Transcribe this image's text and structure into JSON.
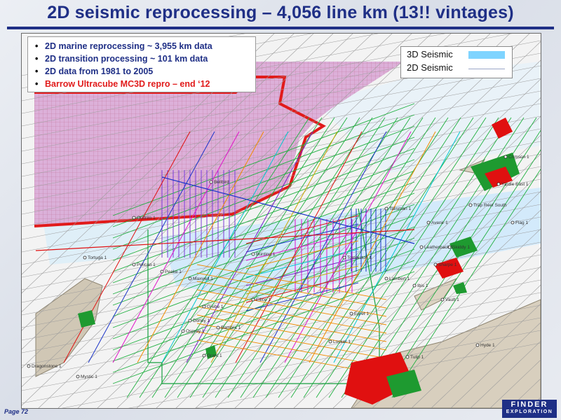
{
  "title": "2D seismic reprocessing – 4,056 line km (13!! vintages)",
  "bullets": [
    {
      "text": "2D marine reprocessing ~ 3,955 km data",
      "highlight": false
    },
    {
      "text": "2D transition processing ~ 101 km data",
      "highlight": false
    },
    {
      "text": "2D data from 1981 to 2005",
      "highlight": false
    },
    {
      "text": "Barrow Ultracube MC3D repro – end ‘12",
      "highlight": true
    }
  ],
  "legend": {
    "items": [
      {
        "label": "3D Seismic",
        "color": "#7fd4ff"
      },
      {
        "label": "2D Seismic",
        "color": "#9aa6c8"
      }
    ]
  },
  "map": {
    "colors": {
      "cube_fill": "#b98bc4",
      "cube_outline": "#e11b1b",
      "survey_3d": "#bfe3ff",
      "grey_lines": "#9c9c9c",
      "green_lines": "#20b040",
      "hydrocarbon": "#e01010",
      "islands": "#d0c7b5"
    },
    "well_labels": [
      "Bellbird",
      "Outtrim 1",
      "Tortuga 1",
      "Pelican 1",
      "Peake 1",
      "Maxwell 1",
      "Mystic 1",
      "Dragonstone 1",
      "Grant 1",
      "Trap Reef South",
      "Crimson 1",
      "Yardie East 1",
      "Doney 1",
      "Locker 1",
      "Skiddy 1",
      "Tulip 1",
      "Flag 1",
      "Hyde 1",
      "Avenir 1",
      "Sharpe 1",
      "Leatherback 1",
      "Vault 1",
      "Tombiston 1",
      "Ellice 1",
      "Bunting 1",
      "Talisman 1",
      "Lambert 1",
      "Ibis 1",
      "Grebe 1",
      "Bambra 1",
      "Osprey 1",
      "Egret 1"
    ]
  },
  "footer": {
    "page": "Page 72",
    "logo_line1": "FINDER",
    "logo_line2": "EXPLORATION"
  }
}
